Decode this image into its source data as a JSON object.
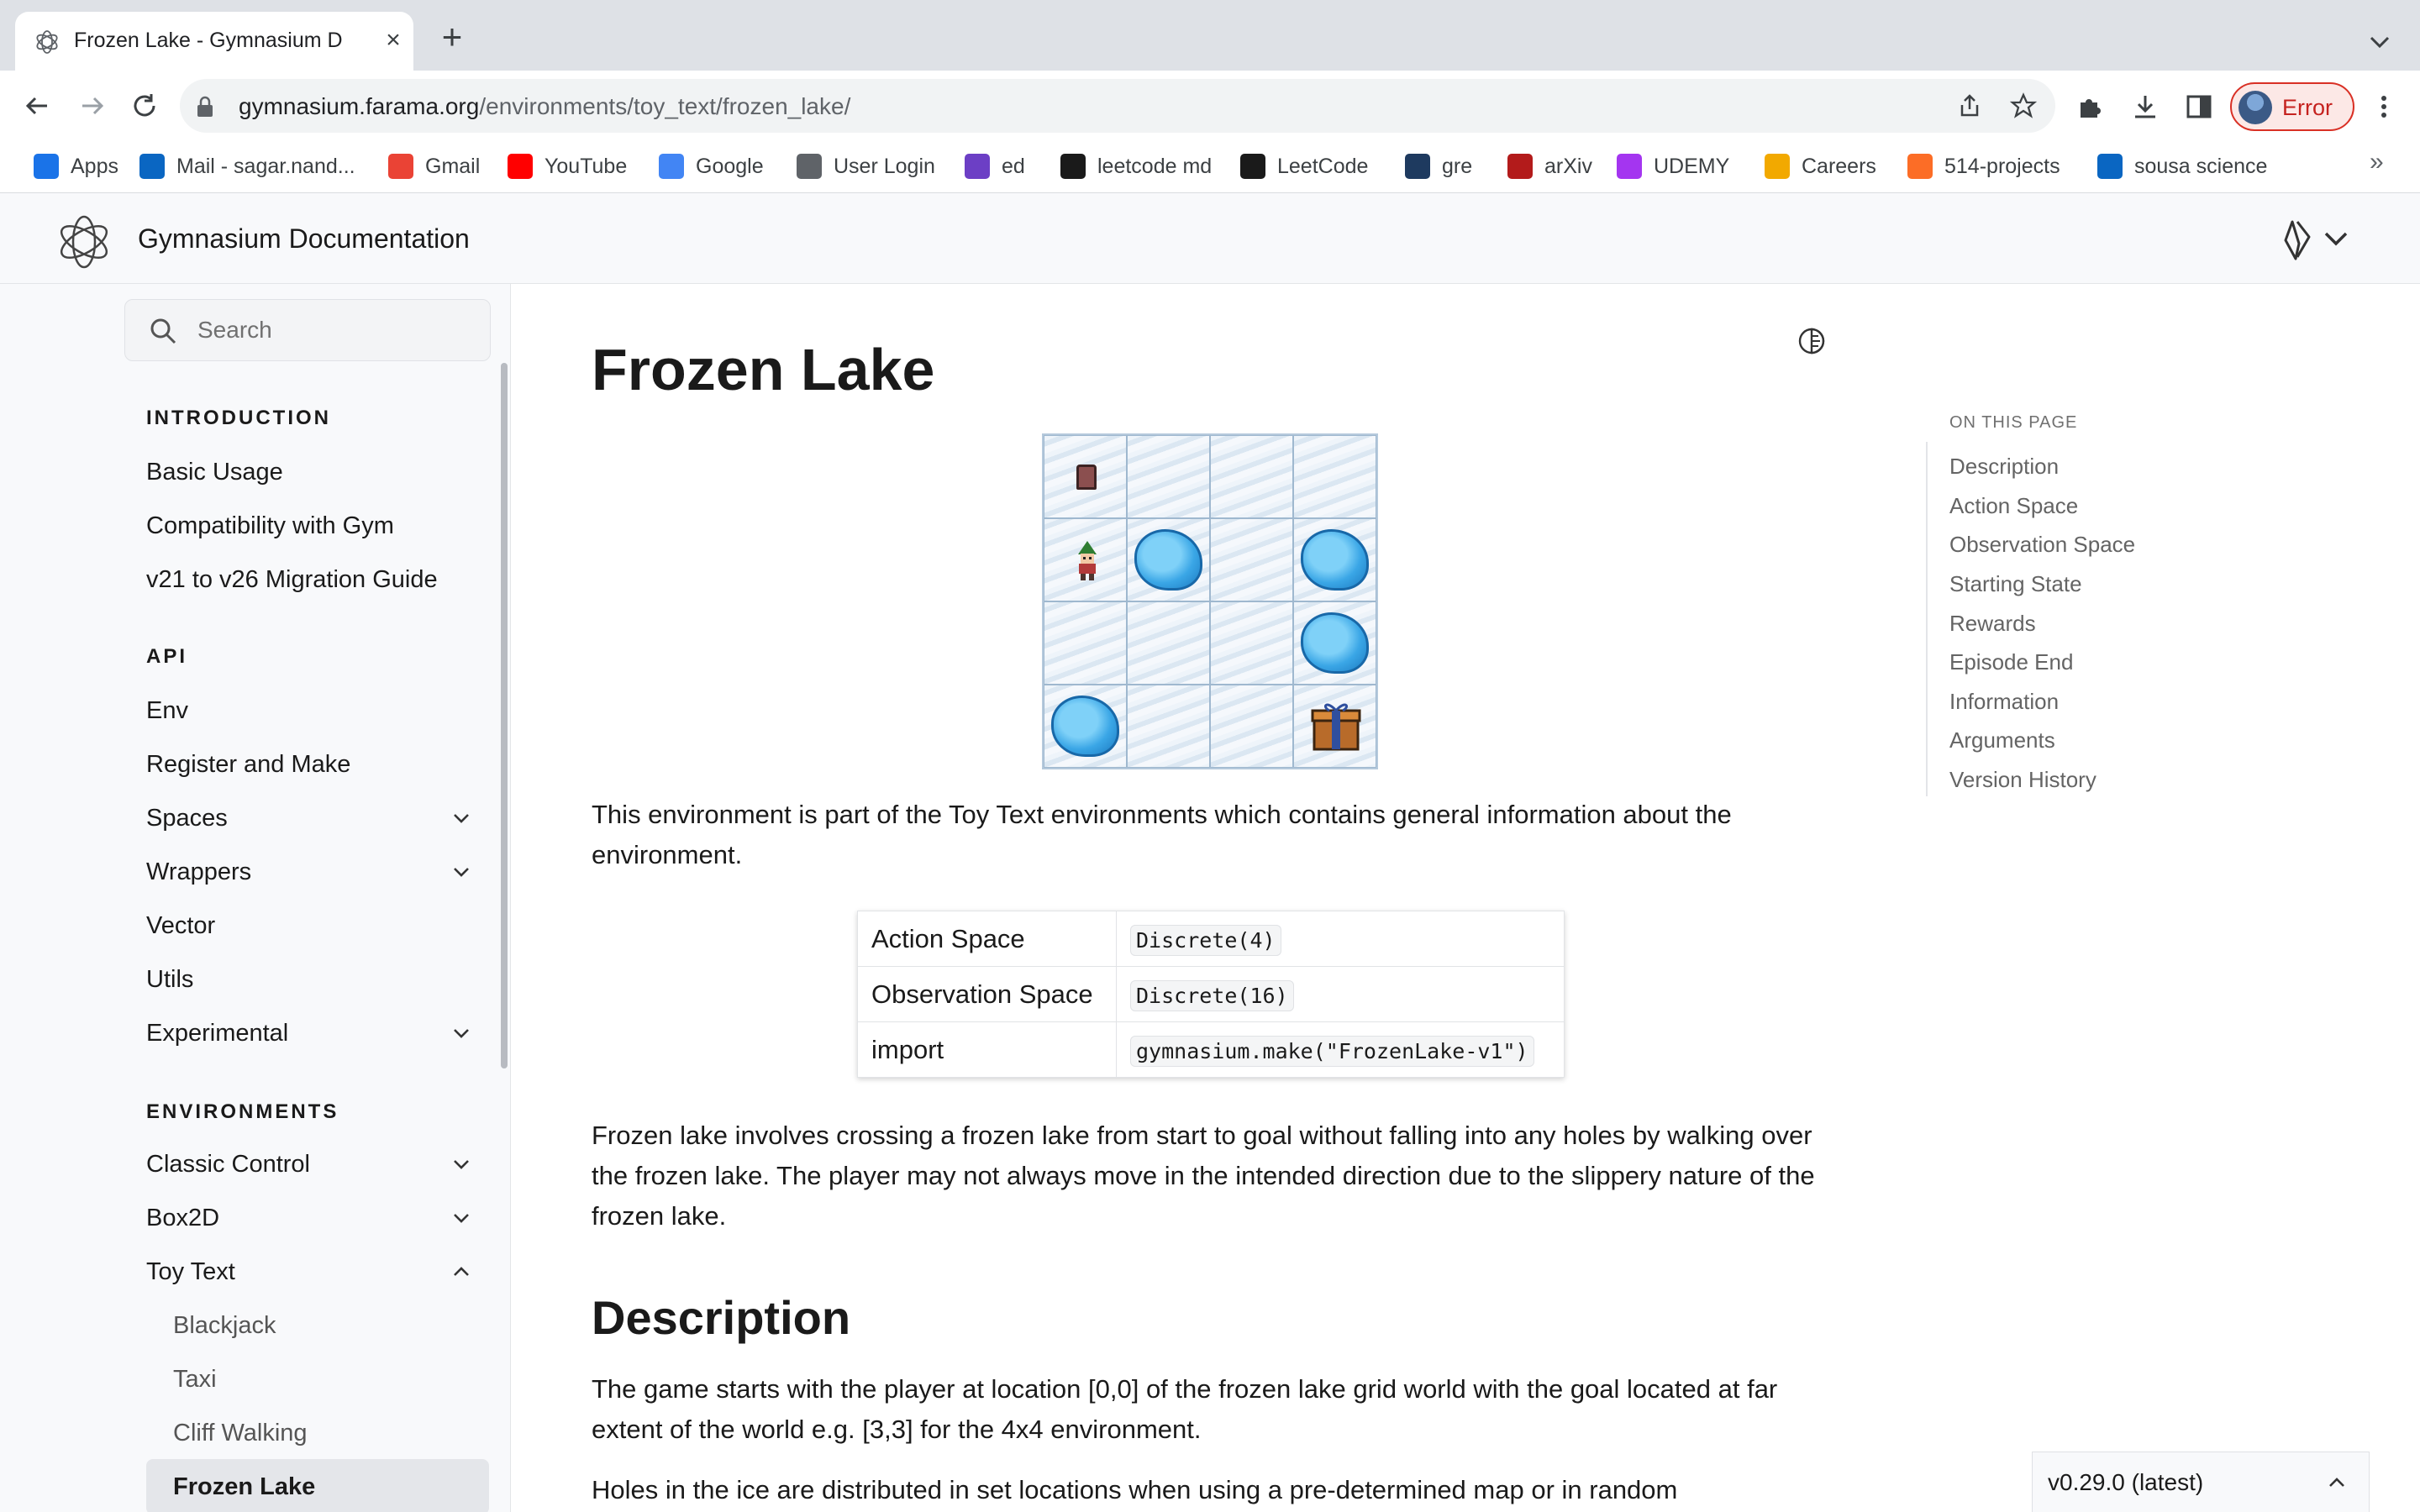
{
  "browser": {
    "tab": {
      "title": "Frozen Lake - Gymnasium Documentation"
    },
    "url": {
      "host": "gymnasium.farama.org",
      "path": "/environments/toy_text/frozen_lake/"
    },
    "profile_status": "Error",
    "bookmarks": [
      {
        "label": "Apps",
        "icon": "apps-grid-icon",
        "color": "#1a73e8"
      },
      {
        "label": "Mail - sagar.nand...",
        "icon": "outlook-icon",
        "color": "#0a66c2"
      },
      {
        "label": "Gmail",
        "icon": "gmail-icon",
        "color": "#ea4335"
      },
      {
        "label": "YouTube",
        "icon": "youtube-icon",
        "color": "#ff0000"
      },
      {
        "label": "Google",
        "icon": "google-icon",
        "color": "#4285f4"
      },
      {
        "label": "User Login",
        "icon": "globe-icon",
        "color": "#5f6368"
      },
      {
        "label": "ed",
        "icon": "ed-icon",
        "color": "#6c3fc5"
      },
      {
        "label": "leetcode md",
        "icon": "leetcode-icon",
        "color": "#1a1a1a"
      },
      {
        "label": "LeetCode",
        "icon": "leetcode-icon",
        "color": "#1a1a1a"
      },
      {
        "label": "gre",
        "icon": "gre-icon",
        "color": "#1e3a5f"
      },
      {
        "label": "arXiv",
        "icon": "arxiv-icon",
        "color": "#b31b1b"
      },
      {
        "label": "UDEMY",
        "icon": "udemy-icon",
        "color": "#a435f0"
      },
      {
        "label": "Careers",
        "icon": "careers-icon",
        "color": "#f2a900"
      },
      {
        "label": "514-projects",
        "icon": "gitlab-icon",
        "color": "#fc6d26"
      },
      {
        "label": "sousa science",
        "icon": "outlook-icon",
        "color": "#0a66c2"
      }
    ],
    "bookmarks_overflow": "»"
  },
  "site": {
    "title": "Gymnasium Documentation"
  },
  "sidebar": {
    "search_placeholder": "Search",
    "sections": [
      {
        "caption": "INTRODUCTION",
        "items": [
          "Basic Usage",
          "Compatibility with Gym",
          "v21 to v26 Migration Guide"
        ]
      },
      {
        "caption": "API",
        "items": [
          "Env",
          "Register and Make",
          "Spaces",
          "Wrappers",
          "Vector",
          "Utils",
          "Experimental"
        ]
      },
      {
        "caption": "ENVIRONMENTS",
        "items": [
          "Classic Control",
          "Box2D",
          "Toy Text"
        ]
      }
    ],
    "toy_text_children": [
      "Blackjack",
      "Taxi",
      "Cliff Walking",
      "Frozen Lake"
    ]
  },
  "main": {
    "title": "Frozen Lake",
    "intro": "This environment is part of the Toy Text environments which contains general information about the environment.",
    "spec_table": [
      {
        "key": "Action Space",
        "value": "Discrete(4)"
      },
      {
        "key": "Observation Space",
        "value": "Discrete(16)"
      },
      {
        "key": "import",
        "value": "gymnasium.make(\"FrozenLake-v1\")"
      }
    ],
    "summary": "Frozen lake involves crossing a frozen lake from start to goal without falling into any holes by walking over the frozen lake. The player may not always move in the intended direction due to the slippery nature of the frozen lake.",
    "description_heading": "Description",
    "description_p1": "The game starts with the player at location [0,0] of the frozen lake grid world with the goal located at far extent of the world e.g. [3,3] for the 4x4 environment.",
    "description_p2": "Holes in the ice are distributed in set locations when using a pre-determined map or in random"
  },
  "toc": {
    "caption": "ON THIS PAGE",
    "items": [
      "Description",
      "Action Space",
      "Observation Space",
      "Starting State",
      "Rewards",
      "Episode End",
      "Information",
      "Arguments",
      "Version History"
    ]
  },
  "version": {
    "label": "v0.29.0 (latest)"
  }
}
